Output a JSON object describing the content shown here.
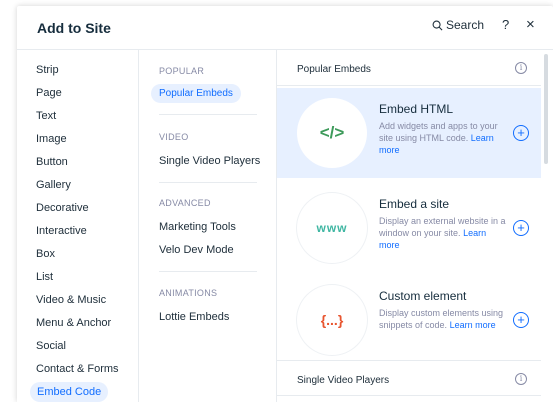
{
  "header": {
    "title": "Add to Site",
    "search_label": "Search",
    "help_label": "?",
    "close_label": "×"
  },
  "categories": [
    "Strip",
    "Page",
    "Text",
    "Image",
    "Button",
    "Gallery",
    "Decorative",
    "Interactive",
    "Box",
    "List",
    "Video & Music",
    "Menu & Anchor",
    "Social",
    "Contact & Forms",
    "Embed Code"
  ],
  "subcategories": {
    "popular_heading": "POPULAR",
    "popular_item": "Popular Embeds",
    "video_heading": "VIDEO",
    "video_item": "Single Video Players",
    "advanced_heading": "ADVANCED",
    "advanced_item_1": "Marketing Tools",
    "advanced_item_2": "Velo Dev Mode",
    "animations_heading": "ANIMATIONS",
    "animations_item": "Lottie Embeds"
  },
  "content": {
    "section_popular": "Popular Embeds",
    "section_video": "Single Video Players",
    "info_glyph": "i",
    "plus_glyph": "+",
    "cards": [
      {
        "title": "Embed HTML",
        "desc": "Add widgets and apps to your site using HTML code.",
        "link": "Learn more",
        "glyph": "</>",
        "glyph_color": "#3d9a5a"
      },
      {
        "title": "Embed a site",
        "desc": "Display an external website in a window on your site.",
        "link": "Learn more",
        "glyph": "www",
        "glyph_color": "#3fb6a2"
      },
      {
        "title": "Custom element",
        "desc": "Display custom elements using snippets of code.",
        "link": "Learn more",
        "glyph": "{...}",
        "glyph_color": "#e8552f"
      }
    ]
  },
  "colors": {
    "accent": "#116dff",
    "selected_bg": "#e7f0ff",
    "muted": "#868aa5"
  }
}
